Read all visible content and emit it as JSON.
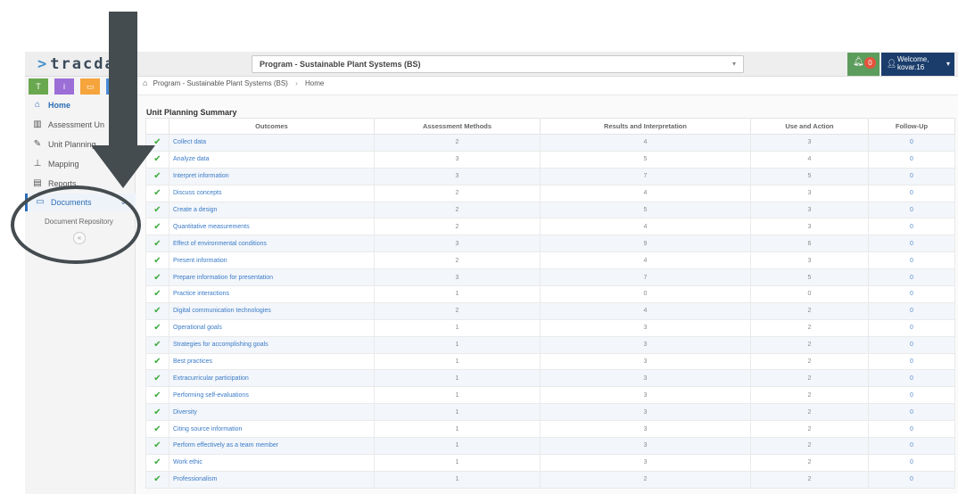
{
  "app": {
    "logo_text": "tracda",
    "logo_chevron": ">"
  },
  "header": {
    "program_select_value": "Program - Sustainable Plant Systems (BS)",
    "notification_count": "0",
    "welcome_line1": "Welcome,",
    "welcome_line2": "kovar.16"
  },
  "colors": {
    "quick_green": "#6aa84f",
    "quick_purple": "#9b6fd6",
    "quick_orange": "#f6a43c",
    "quick_blue": "#4a8bd6",
    "accent": "#2d6db5",
    "check": "#3caa3c"
  },
  "quick_buttons": [
    {
      "label": "T",
      "icon": "text-icon"
    },
    {
      "label": "i",
      "icon": "info-icon"
    },
    {
      "label": "▭",
      "icon": "calendar-icon"
    },
    {
      "label": "",
      "icon": "blank-icon"
    }
  ],
  "sidebar": {
    "items": [
      {
        "label": "Home",
        "icon": "home-icon",
        "glyph": "⌂"
      },
      {
        "label": "Assessment Un",
        "icon": "institution-icon",
        "glyph": "▥"
      },
      {
        "label": "Unit Planning",
        "icon": "pencil-icon",
        "glyph": "✎"
      },
      {
        "label": "Mapping",
        "icon": "sitemap-icon",
        "glyph": "⊥"
      },
      {
        "label": "Reports",
        "icon": "reports-icon",
        "glyph": "▤"
      },
      {
        "label": "Documents",
        "icon": "folder-icon",
        "glyph": "▭"
      }
    ],
    "sub_item": "Document Repository",
    "collapse_glyph": "«"
  },
  "breadcrumb": {
    "program": "Program - Sustainable Plant Systems (BS)",
    "separator": "›",
    "current": "Home"
  },
  "main": {
    "section_title": "Unit Planning Summary",
    "columns": [
      "",
      "Outcomes",
      "Assessment Methods",
      "Results and Interpretation",
      "Use and Action",
      "Follow-Up"
    ],
    "check_glyph": "✔",
    "rows": [
      {
        "outcome": "Collect data",
        "methods": "2",
        "results": "4",
        "use": "3",
        "follow": "0"
      },
      {
        "outcome": "Analyze data",
        "methods": "3",
        "results": "5",
        "use": "4",
        "follow": "0"
      },
      {
        "outcome": "Interpret information",
        "methods": "3",
        "results": "7",
        "use": "5",
        "follow": "0"
      },
      {
        "outcome": "Discuss concepts",
        "methods": "2",
        "results": "4",
        "use": "3",
        "follow": "0"
      },
      {
        "outcome": "Create a design",
        "methods": "2",
        "results": "5",
        "use": "3",
        "follow": "0"
      },
      {
        "outcome": "Quantitative measurements",
        "methods": "2",
        "results": "4",
        "use": "3",
        "follow": "0"
      },
      {
        "outcome": "Effect of environmental conditions",
        "methods": "3",
        "results": "9",
        "use": "6",
        "follow": "0"
      },
      {
        "outcome": "Present information",
        "methods": "2",
        "results": "4",
        "use": "3",
        "follow": "0"
      },
      {
        "outcome": "Prepare information for presentation",
        "methods": "3",
        "results": "7",
        "use": "5",
        "follow": "0"
      },
      {
        "outcome": "Practice interactions",
        "methods": "1",
        "results": "0",
        "use": "0",
        "follow": "0"
      },
      {
        "outcome": "Digital communication technologies",
        "methods": "2",
        "results": "4",
        "use": "2",
        "follow": "0"
      },
      {
        "outcome": "Operational goals",
        "methods": "1",
        "results": "3",
        "use": "2",
        "follow": "0"
      },
      {
        "outcome": "Strategies for accomplishing goals",
        "methods": "1",
        "results": "3",
        "use": "2",
        "follow": "0"
      },
      {
        "outcome": "Best practices",
        "methods": "1",
        "results": "3",
        "use": "2",
        "follow": "0"
      },
      {
        "outcome": "Extracurricular participation",
        "methods": "1",
        "results": "3",
        "use": "2",
        "follow": "0"
      },
      {
        "outcome": "Performing self-evaluations",
        "methods": "1",
        "results": "3",
        "use": "2",
        "follow": "0"
      },
      {
        "outcome": "Diversity",
        "methods": "1",
        "results": "3",
        "use": "2",
        "follow": "0"
      },
      {
        "outcome": "Citing source information",
        "methods": "1",
        "results": "3",
        "use": "2",
        "follow": "0"
      },
      {
        "outcome": "Perform effectively as a team member",
        "methods": "1",
        "results": "3",
        "use": "2",
        "follow": "0"
      },
      {
        "outcome": "Work ethic",
        "methods": "1",
        "results": "3",
        "use": "2",
        "follow": "0"
      },
      {
        "outcome": "Professionalism",
        "methods": "1",
        "results": "2",
        "use": "2",
        "follow": "0"
      }
    ]
  }
}
